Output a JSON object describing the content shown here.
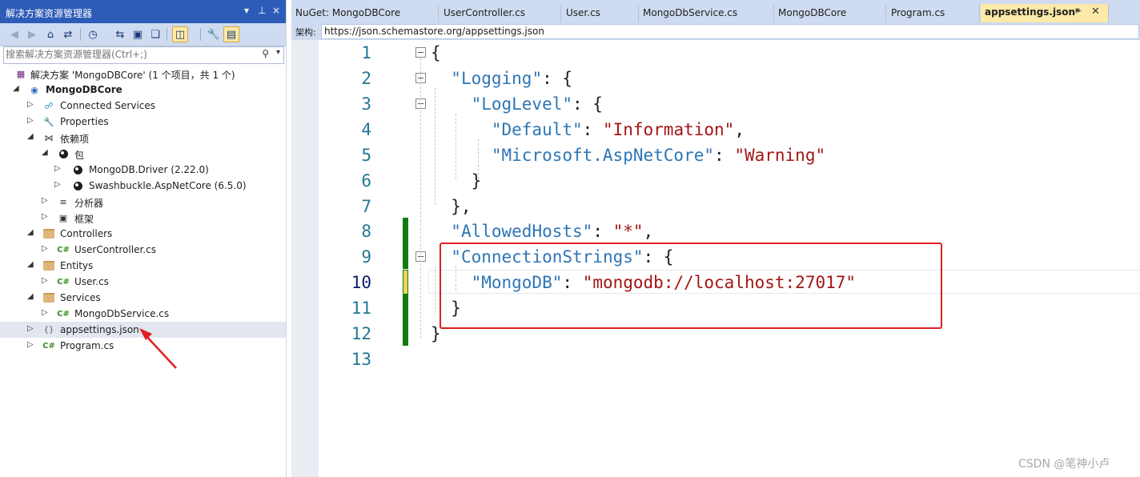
{
  "solution_explorer": {
    "title": "解决方案资源管理器",
    "title_controls": [
      "▾",
      "⊥",
      "×"
    ],
    "search_placeholder": "搜索解决方案资源管理器(Ctrl+;)",
    "tree": [
      {
        "label": "解决方案 'MongoDBCore' (1 个项目，共 1 个)",
        "icon": "solution-icon"
      },
      {
        "label": "MongoDBCore",
        "icon": "csharp-project-icon"
      },
      {
        "label": "Connected Services",
        "icon": "connected-services-icon"
      },
      {
        "label": "Properties",
        "icon": "properties-icon"
      },
      {
        "label": "依赖项",
        "icon": "dependencies-icon"
      },
      {
        "label": "包",
        "icon": "package-icon"
      },
      {
        "label": "MongoDB.Driver (2.22.0)",
        "icon": "nuget-package-icon"
      },
      {
        "label": "Swashbuckle.AspNetCore (6.5.0)",
        "icon": "nuget-package-icon"
      },
      {
        "label": "分析器",
        "icon": "analyzer-icon"
      },
      {
        "label": "框架",
        "icon": "framework-icon"
      },
      {
        "label": "Controllers",
        "icon": "folder-icon"
      },
      {
        "label": "UserController.cs",
        "icon": "csharp-file-icon"
      },
      {
        "label": "Entitys",
        "icon": "folder-icon"
      },
      {
        "label": "User.cs",
        "icon": "csharp-file-icon"
      },
      {
        "label": "Services",
        "icon": "folder-icon"
      },
      {
        "label": "MongoDbService.cs",
        "icon": "csharp-file-icon"
      },
      {
        "label": "appsettings.json",
        "icon": "json-file-icon"
      },
      {
        "label": "Program.cs",
        "icon": "csharp-file-icon"
      }
    ]
  },
  "editor": {
    "tabs": [
      {
        "label": "NuGet: MongoDBCore"
      },
      {
        "label": "UserController.cs"
      },
      {
        "label": "User.cs"
      },
      {
        "label": "MongoDbService.cs"
      },
      {
        "label": "MongoDBCore"
      },
      {
        "label": "Program.cs"
      },
      {
        "label": "appsettings.json*"
      }
    ],
    "schema_label": "架构:",
    "schema_url": "https://json.schemastore.org/appsettings.json",
    "line_numbers": [
      "1",
      "2",
      "3",
      "4",
      "5",
      "6",
      "7",
      "8",
      "9",
      "10",
      "11",
      "12",
      "13"
    ],
    "lines": [
      [
        {
          "t": "{",
          "c": "p"
        }
      ],
      [
        {
          "t": "  ",
          "c": "p"
        },
        {
          "t": "\"Logging\"",
          "c": "k"
        },
        {
          "t": ": {",
          "c": "p"
        }
      ],
      [
        {
          "t": "    ",
          "c": "p"
        },
        {
          "t": "\"LogLevel\"",
          "c": "k"
        },
        {
          "t": ": {",
          "c": "p"
        }
      ],
      [
        {
          "t": "      ",
          "c": "p"
        },
        {
          "t": "\"Default\"",
          "c": "k"
        },
        {
          "t": ": ",
          "c": "p"
        },
        {
          "t": "\"Information\"",
          "c": "s"
        },
        {
          "t": ",",
          "c": "p"
        }
      ],
      [
        {
          "t": "      ",
          "c": "p"
        },
        {
          "t": "\"Microsoft.AspNetCore\"",
          "c": "k"
        },
        {
          "t": ": ",
          "c": "p"
        },
        {
          "t": "\"Warning\"",
          "c": "s"
        }
      ],
      [
        {
          "t": "    }",
          "c": "p"
        }
      ],
      [
        {
          "t": "  },",
          "c": "p"
        }
      ],
      [
        {
          "t": "  ",
          "c": "p"
        },
        {
          "t": "\"AllowedHosts\"",
          "c": "k"
        },
        {
          "t": ": ",
          "c": "p"
        },
        {
          "t": "\"*\"",
          "c": "s"
        },
        {
          "t": ",",
          "c": "p"
        }
      ],
      [
        {
          "t": "  ",
          "c": "p"
        },
        {
          "t": "\"ConnectionStrings\"",
          "c": "k"
        },
        {
          "t": ": {",
          "c": "p"
        }
      ],
      [
        {
          "t": "    ",
          "c": "p"
        },
        {
          "t": "\"MongoDB\"",
          "c": "k"
        },
        {
          "t": ": ",
          "c": "p"
        },
        {
          "t": "\"mongodb://localhost:27017\"",
          "c": "s"
        }
      ],
      [
        {
          "t": "  }",
          "c": "p"
        }
      ],
      [
        {
          "t": "}",
          "c": "p"
        }
      ],
      [
        {
          "t": "",
          "c": "p"
        }
      ]
    ]
  },
  "colors": {
    "key": "#2e75b6",
    "string": "#a31515",
    "line_number": "#237893",
    "change_saved": "#107c10",
    "annotation": "#e02020",
    "title_bar": "#2d5cb8"
  },
  "watermark": "CSDN @笔神小卢"
}
